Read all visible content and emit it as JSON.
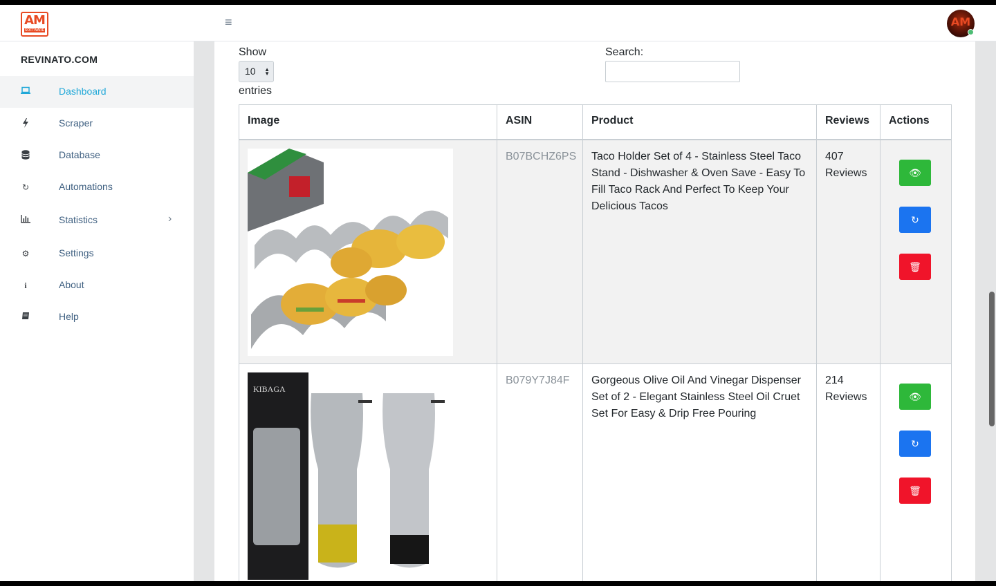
{
  "header": {
    "logo_text": "AM",
    "logo_sub": "SOFTWARE",
    "avatar_text": "AM"
  },
  "sidebar": {
    "brand": "REVINATO.COM",
    "items": [
      {
        "label": "Dashboard",
        "icon": "laptop-icon"
      },
      {
        "label": "Scraper",
        "icon": "bolt-icon"
      },
      {
        "label": "Database",
        "icon": "database-icon"
      },
      {
        "label": "Automations",
        "icon": "refresh-icon"
      },
      {
        "label": "Statistics",
        "icon": "bar-chart-icon"
      },
      {
        "label": "Settings",
        "icon": "cogs-icon"
      },
      {
        "label": "About",
        "icon": "info-icon"
      },
      {
        "label": "Help",
        "icon": "book-icon"
      }
    ]
  },
  "controls": {
    "show_label": "Show",
    "page_size": "10",
    "entries_label": "entries",
    "search_label": "Search:",
    "search_value": ""
  },
  "table": {
    "headers": [
      "Image",
      "ASIN",
      "Product",
      "Reviews",
      "Actions"
    ],
    "rows": [
      {
        "asin": "B07BCHZ6PS",
        "product": "Taco Holder Set of 4 - Stainless Steel Taco Stand - Dishwasher & Oven Save - Easy To Fill Taco Rack And Perfect To Keep Your Delicious Tacos",
        "reviews_count": "407",
        "reviews_label": "Reviews"
      },
      {
        "asin": "B079Y7J84F",
        "product": "Gorgeous Olive Oil And Vinegar Dispenser Set of 2 - Elegant Stainless Steel Oil Cruet Set For Easy & Drip Free Pouring",
        "reviews_count": "214",
        "reviews_label": "Reviews",
        "image_brand": "KIBAGA"
      }
    ]
  },
  "colors": {
    "accent": "#20a8d8",
    "view": "#2eb83a",
    "sync": "#1b74f0",
    "delete": "#f0142a"
  }
}
